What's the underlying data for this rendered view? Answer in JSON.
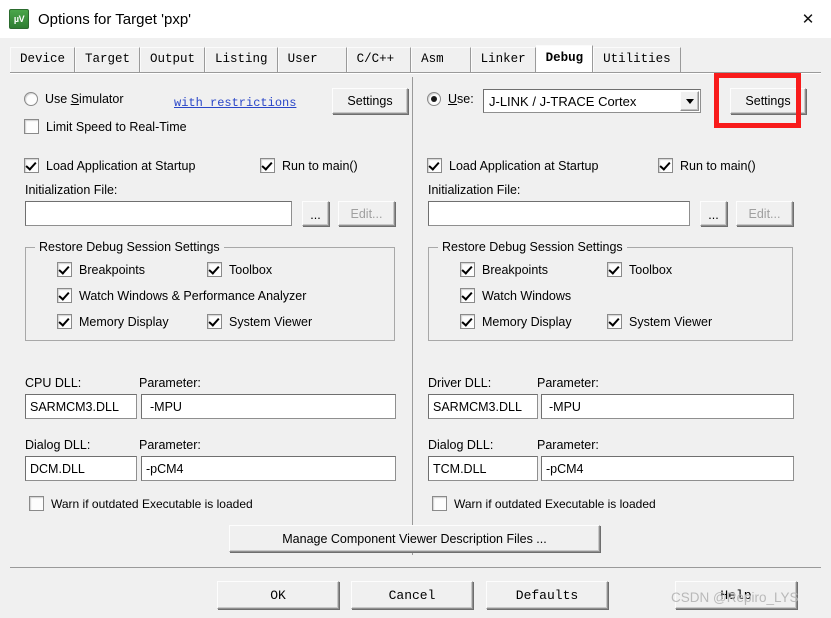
{
  "window": {
    "title": "Options for Target 'pxp'",
    "icon": "keil-uvision-icon",
    "close_label": "✕"
  },
  "tabs": [
    {
      "label": "Device",
      "active": false
    },
    {
      "label": "Target",
      "active": false
    },
    {
      "label": "Output",
      "active": false
    },
    {
      "label": "Listing",
      "active": false
    },
    {
      "label": "User",
      "active": false
    },
    {
      "label": "C/C++",
      "active": false
    },
    {
      "label": "Asm",
      "active": false
    },
    {
      "label": "Linker",
      "active": false
    },
    {
      "label": "Debug",
      "active": true
    },
    {
      "label": "Utilities",
      "active": false
    }
  ],
  "left_panel": {
    "use_simulator": {
      "label_pre": "Use ",
      "label_key": "S",
      "label_post": "imulator",
      "checked": false
    },
    "restrictions_link": "with restrictions",
    "settings_button": "Settings",
    "limit_speed": {
      "label": "Limit Speed to Real-Time",
      "checked": false
    },
    "load_app": {
      "label": "Load Application at Startup",
      "checked": true
    },
    "run_to_main": {
      "label": "Run to main()",
      "checked": true
    },
    "init_file_label": "Initialization File:",
    "init_file_value": "",
    "browse_button": "...",
    "edit_button": "Edit...",
    "restore_group": {
      "title": "Restore Debug Session Settings",
      "items": [
        {
          "label": "Breakpoints",
          "checked": true
        },
        {
          "label": "Toolbox",
          "checked": true
        },
        {
          "label": "Watch Windows & Performance Analyzer",
          "checked": true
        },
        {
          "label": "Memory Display",
          "checked": true
        },
        {
          "label": "System Viewer",
          "checked": true
        }
      ]
    },
    "cpu_dll_label": "CPU DLL:",
    "cpu_dll_value": "SARMCM3.DLL",
    "cpu_param_label": "Parameter:",
    "cpu_param_value": "-MPU",
    "dialog_dll_label": "Dialog DLL:",
    "dialog_dll_value": "DCM.DLL",
    "dialog_param_label": "Parameter:",
    "dialog_param_value": "-pCM4",
    "warn_outdated": {
      "label": "Warn if outdated Executable is loaded",
      "checked": false
    }
  },
  "right_panel": {
    "use_radio": {
      "label_key": "U",
      "label_post": "se:",
      "checked": true
    },
    "driver_selected": "J-LINK / J-TRACE Cortex",
    "settings_button": "Settings",
    "load_app": {
      "label": "Load Application at Startup",
      "checked": true
    },
    "run_to_main": {
      "label": "Run to main()",
      "checked": true
    },
    "init_file_label": "Initialization File:",
    "init_file_value": "",
    "browse_button": "...",
    "edit_button": "Edit...",
    "restore_group": {
      "title": "Restore Debug Session Settings",
      "items": [
        {
          "label": "Breakpoints",
          "checked": true
        },
        {
          "label": "Toolbox",
          "checked": true
        },
        {
          "label": "Watch Windows",
          "checked": true
        },
        {
          "label": "Memory Display",
          "checked": true
        },
        {
          "label": "System Viewer",
          "checked": true
        }
      ]
    },
    "driver_dll_label": "Driver DLL:",
    "driver_dll_value": "SARMCM3.DLL",
    "driver_param_label": "Parameter:",
    "driver_param_value": "-MPU",
    "dialog_dll_label": "Dialog DLL:",
    "dialog_dll_value": "TCM.DLL",
    "dialog_param_label": "Parameter:",
    "dialog_param_value": "-pCM4",
    "warn_outdated": {
      "label": "Warn if outdated Executable is loaded",
      "checked": false
    }
  },
  "manage_button": "Manage Component Viewer Description Files ...",
  "footer": {
    "ok": "OK",
    "cancel": "Cancel",
    "defaults": "Defaults",
    "help": "Help"
  },
  "annotation": {
    "color": "#f81b1b",
    "target": "right-settings-button"
  },
  "watermark": "CSDN @Repiro_LYS"
}
